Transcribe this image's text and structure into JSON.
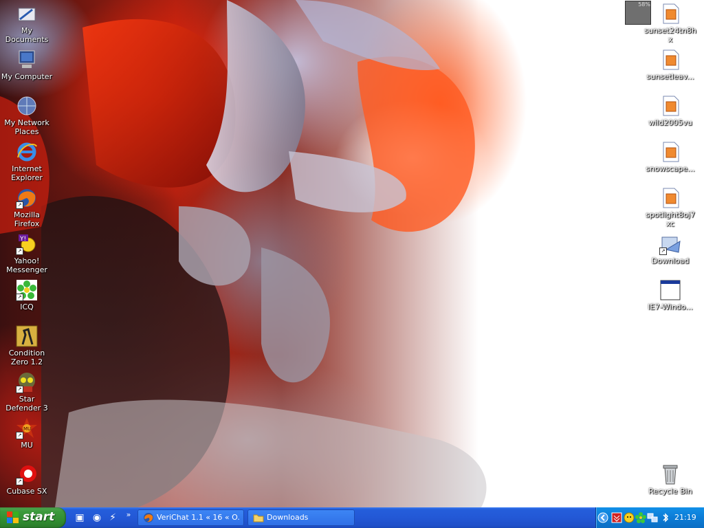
{
  "desktop": {
    "left_icons": [
      {
        "id": "my-documents",
        "label": "My Documents",
        "icon": "folder-documents-icon"
      },
      {
        "id": "my-computer",
        "label": "My Computer",
        "icon": "computer-icon"
      },
      {
        "id": "my-network-places",
        "label": "My Network Places",
        "icon": "network-globe-icon"
      },
      {
        "id": "internet-explorer",
        "label": "Internet Explorer",
        "icon": "internet-explorer-icon"
      },
      {
        "id": "mozilla-firefox",
        "label": "Mozilla Firefox",
        "icon": "firefox-icon"
      },
      {
        "id": "yahoo-messenger",
        "label": "Yahoo! Messenger",
        "icon": "yahoo-messenger-icon"
      },
      {
        "id": "icq",
        "label": "ICQ",
        "icon": "icq-flower-icon"
      },
      {
        "id": "condition-zero",
        "label": "Condition Zero 1.2",
        "icon": "counter-strike-icon"
      },
      {
        "id": "star-defender",
        "label": "Star Defender 3",
        "icon": "star-defender-icon"
      },
      {
        "id": "mu",
        "label": "MU",
        "icon": "mu-game-icon"
      },
      {
        "id": "cubase-sx",
        "label": "Cubase SX",
        "icon": "cubase-icon"
      }
    ],
    "right_icons": [
      {
        "id": "sunset24",
        "label": "sunset24tn8hx",
        "icon": "image-file-icon"
      },
      {
        "id": "sunsetleav",
        "label": "sunsetleav...",
        "icon": "image-file-icon"
      },
      {
        "id": "wild2005",
        "label": "wild2005vu",
        "icon": "image-file-icon"
      },
      {
        "id": "snowscape",
        "label": "snowscape...",
        "icon": "image-file-icon"
      },
      {
        "id": "spotlight",
        "label": "spotlight8oj7xc",
        "icon": "image-file-icon"
      },
      {
        "id": "download",
        "label": "Download",
        "icon": "download-shortcut-icon"
      },
      {
        "id": "ie7-windows",
        "label": "IE7-Windo...",
        "icon": "window-file-icon"
      }
    ],
    "recycle_bin": {
      "label": "Recycle Bin",
      "icon": "recycle-bin-icon"
    },
    "cpu_meter": {
      "value": "58%"
    }
  },
  "taskbar": {
    "start_label": "start",
    "quick_launch": [
      {
        "icon": "show-desktop-icon"
      },
      {
        "icon": "media-player-icon"
      },
      {
        "icon": "winamp-icon"
      }
    ],
    "quick_launch_more": "»",
    "tasks": [
      {
        "label": "VeriChat 1.1 « 16 « O...",
        "icon": "firefox-icon"
      },
      {
        "label": "Downloads",
        "icon": "folder-icon"
      }
    ],
    "tray": {
      "clock": "21:19",
      "icons": [
        "show-hidden-icons-icon",
        "antivirus-icon",
        "yahoo-messenger-icon",
        "icq-flower-icon",
        "network-icon",
        "bluetooth-icon"
      ]
    }
  },
  "colors": {
    "taskbar_blue": "#245edb",
    "start_green": "#3c9a3c",
    "tray_blue": "#0c7cd6"
  }
}
